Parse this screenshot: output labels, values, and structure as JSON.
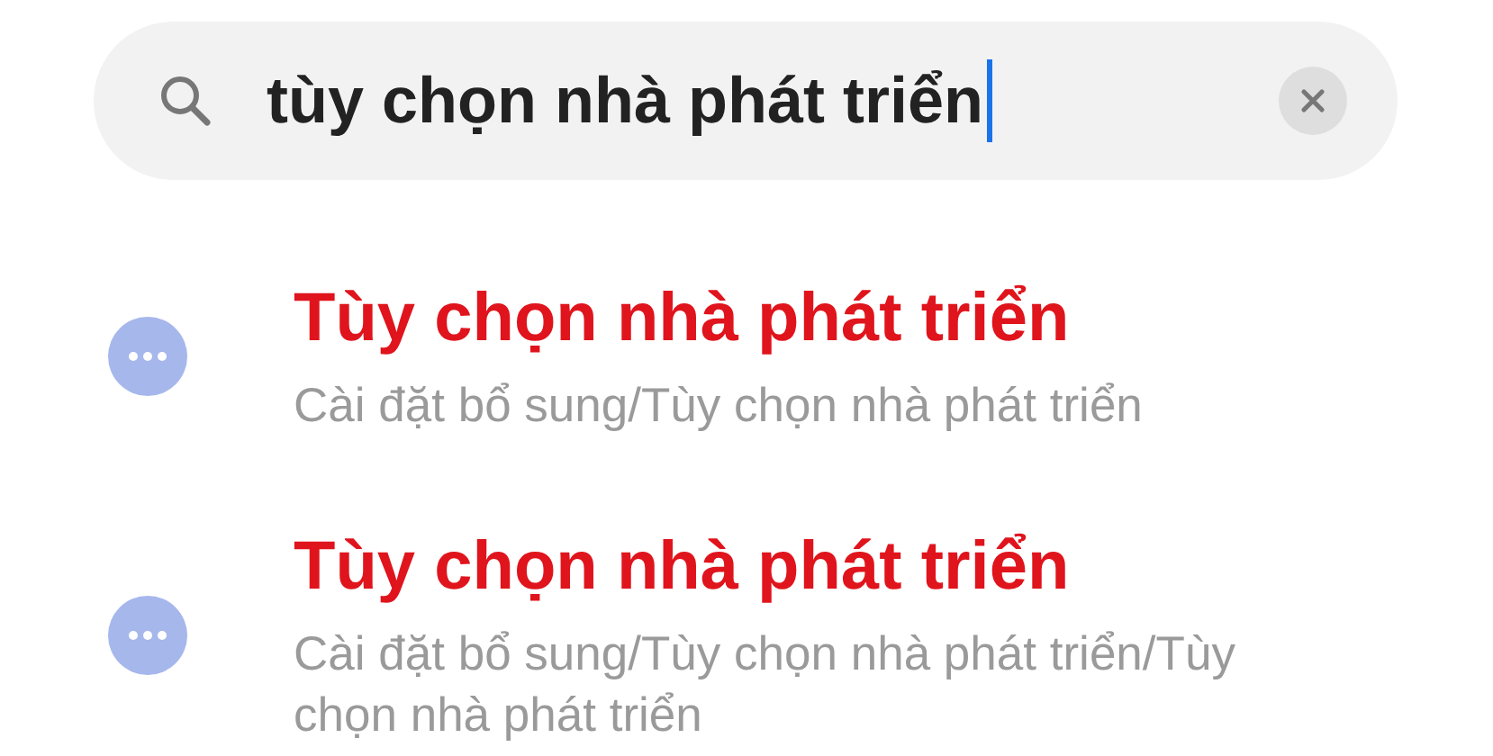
{
  "search": {
    "value": "tùy chọn nhà phát triển",
    "focused": true
  },
  "results": [
    {
      "title": "Tùy chọn nhà phát triển",
      "path": "Cài đặt bổ sung/Tùy chọn nhà phát triển"
    },
    {
      "title": "Tùy chọn nhà phát triển",
      "path": "Cài đặt bổ sung/Tùy chọn nhà phát triển/Tùy chọn nhà phát triển"
    }
  ]
}
